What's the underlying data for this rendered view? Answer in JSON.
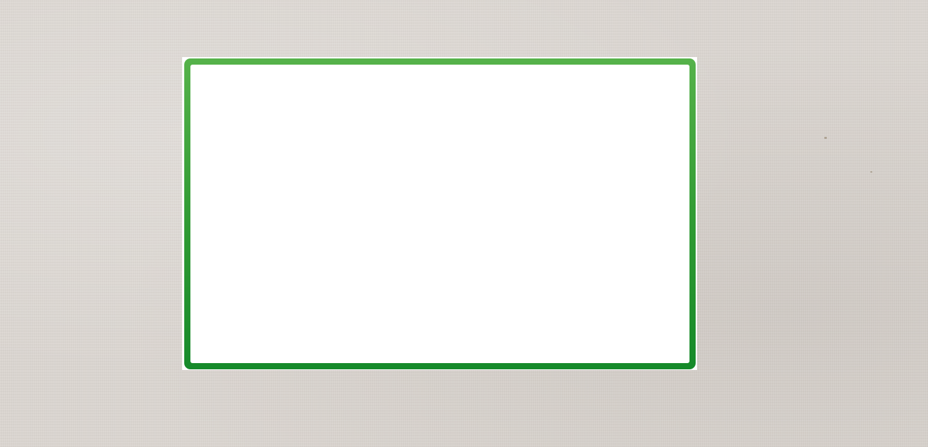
{
  "background": {
    "texture": "linen-paper",
    "color": "#d9d4cf"
  },
  "panel": {
    "border_color_top": "#56b24a",
    "border_color_bottom": "#168a2a",
    "fill_color": "#ffffff",
    "content": []
  }
}
